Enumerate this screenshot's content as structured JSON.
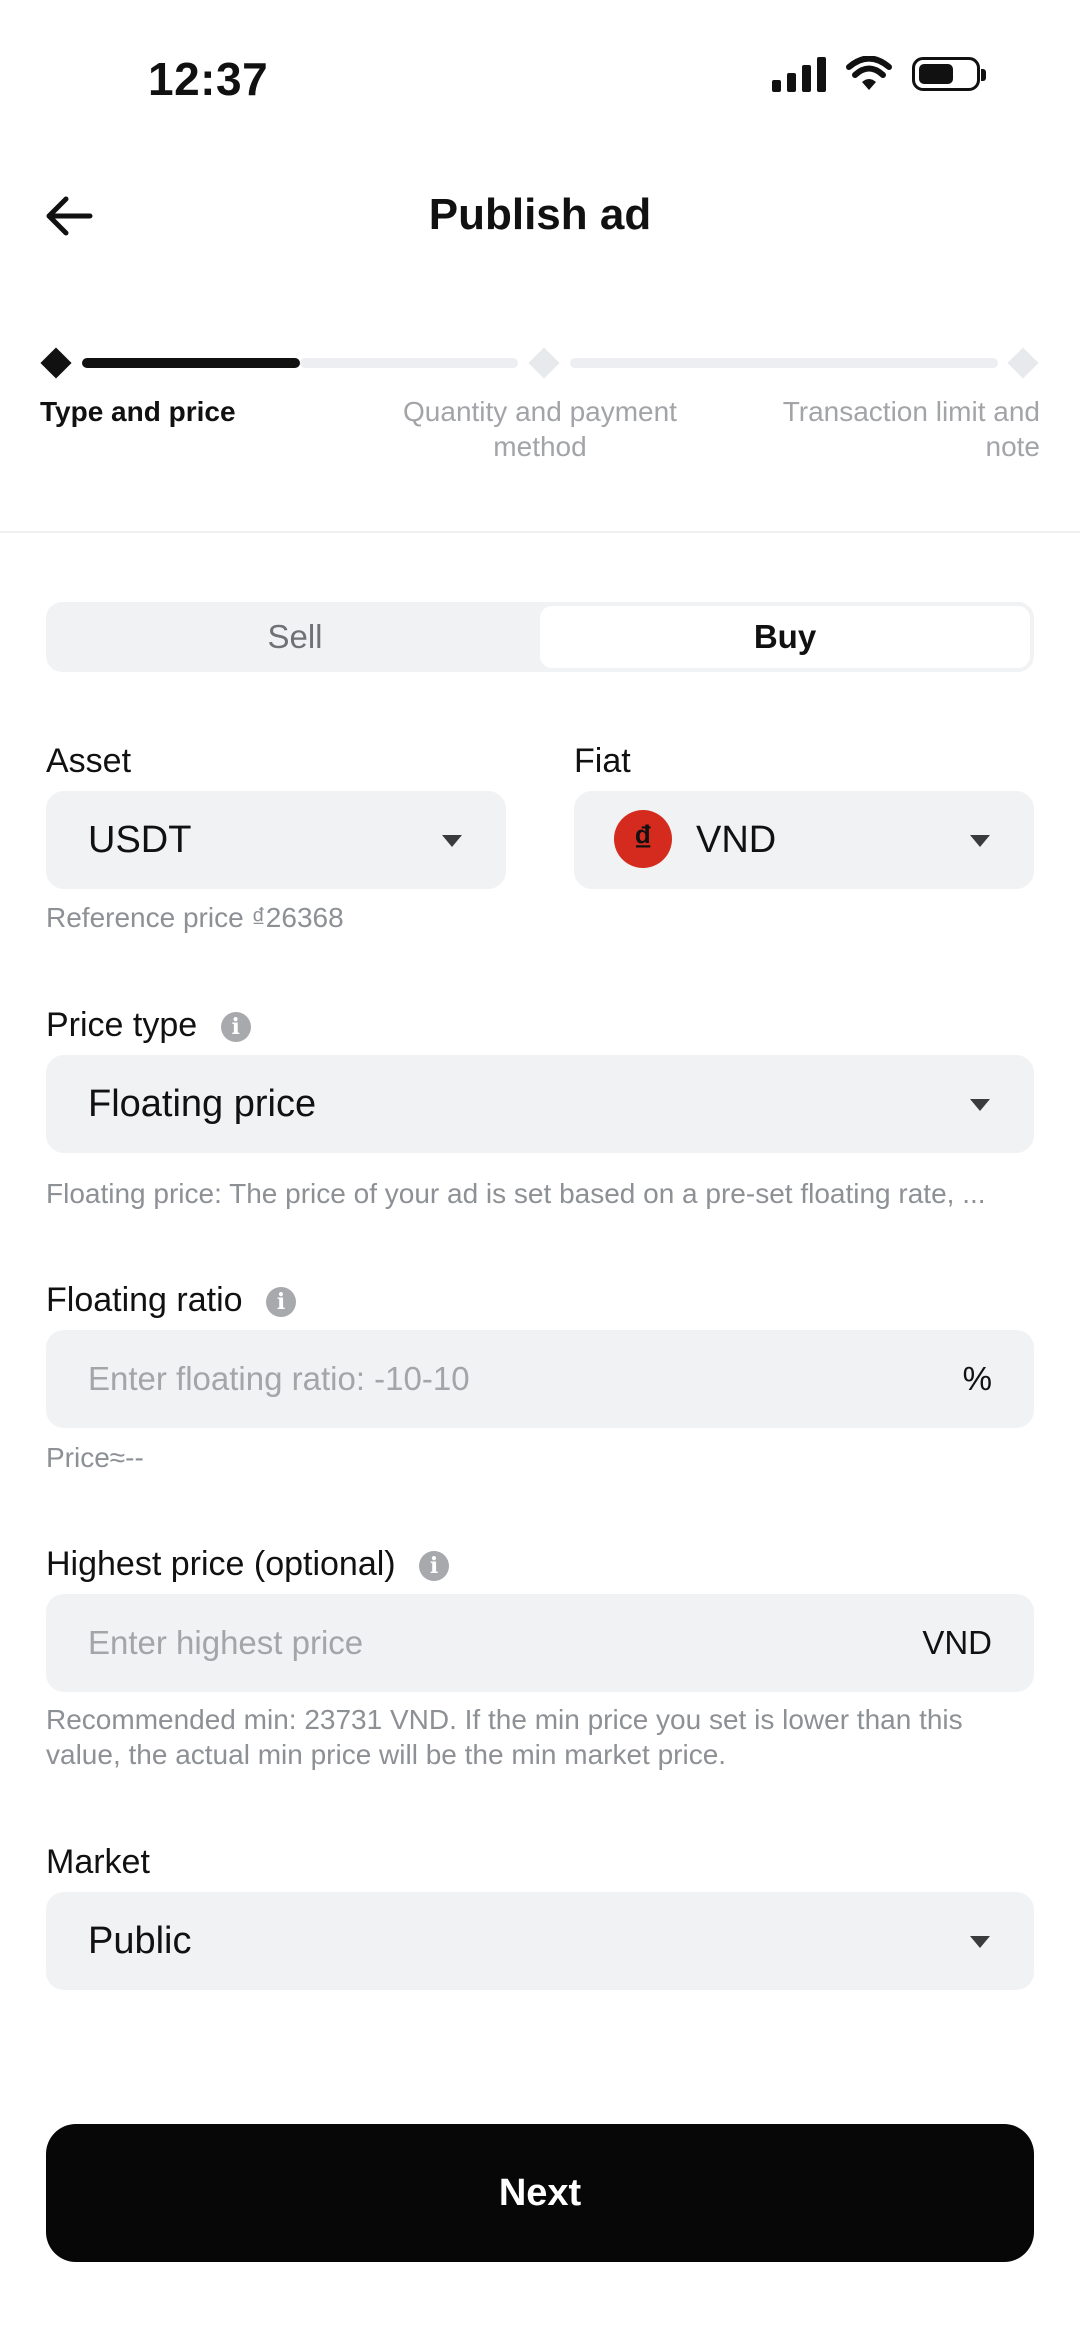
{
  "status_bar": {
    "time": "12:37"
  },
  "header": {
    "title": "Publish ad"
  },
  "stepper": {
    "steps": [
      {
        "label": "Type and price"
      },
      {
        "label": "Quantity and payment method"
      },
      {
        "label": "Transaction limit and note"
      }
    ]
  },
  "segment": {
    "sell_label": "Sell",
    "buy_label": "Buy",
    "selected": "Buy"
  },
  "asset": {
    "label": "Asset",
    "value": "USDT"
  },
  "fiat": {
    "label": "Fiat",
    "value": "VND",
    "symbol": "₫",
    "symbol_color": "#d52b1e"
  },
  "reference_price": "Reference price ₫26368",
  "price_type": {
    "label": "Price type",
    "value": "Floating price",
    "hint": "Floating price: The price of your ad is set based on a pre-set floating rate, ..."
  },
  "floating_ratio": {
    "label": "Floating ratio",
    "placeholder": "Enter floating ratio: -10-10",
    "unit": "%",
    "price_hint": "Price≈--"
  },
  "highest_price": {
    "label": "Highest price (optional)",
    "placeholder": "Enter highest price",
    "unit": "VND",
    "hint_line1": "Recommended min: 23731 VND. If the min price you set is lower than this",
    "hint_line2": "value, the actual min price will be the min market price."
  },
  "market": {
    "label": "Market",
    "value": "Public"
  },
  "next_button": {
    "label": "Next"
  },
  "colors": {
    "accent": "#070707",
    "field_bg": "#f1f2f4",
    "muted_text": "#8d9094"
  },
  "icons": [
    "signal-icon",
    "wifi-icon",
    "battery-icon",
    "back-arrow-icon",
    "info-icon",
    "chevron-down-icon"
  ]
}
